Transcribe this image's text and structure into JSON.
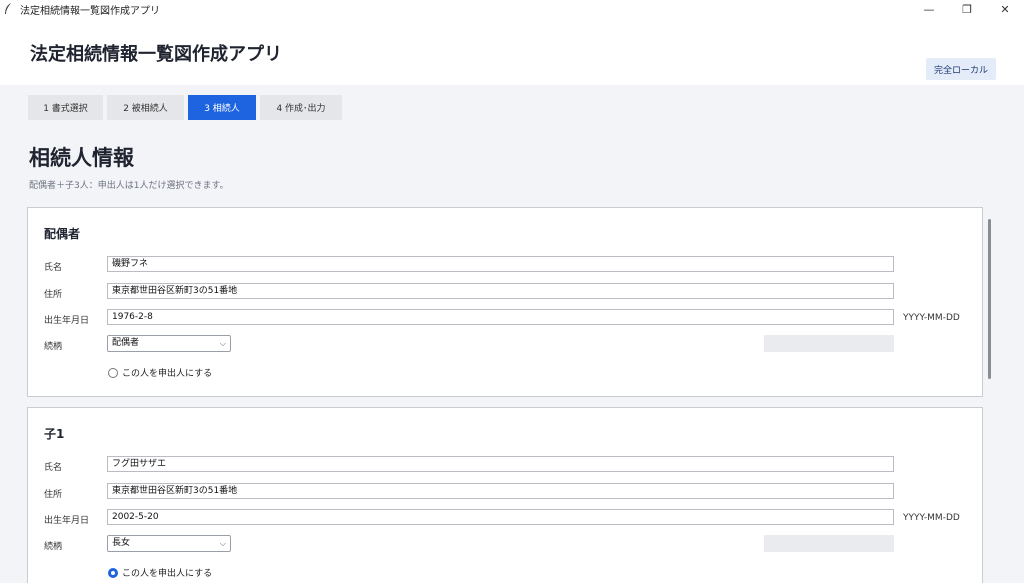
{
  "window": {
    "title": "法定相続情報一覧図作成アプリ",
    "minimize": "—",
    "restore": "❐",
    "close": "✕"
  },
  "header": {
    "app_title": "法定相続情報一覧図作成アプリ",
    "badge": "完全ローカル"
  },
  "steps": [
    {
      "label": "1  書式選択",
      "active": false
    },
    {
      "label": "2  被相続人",
      "active": false
    },
    {
      "label": "3  相続人",
      "active": true
    },
    {
      "label": "4  作成･出力",
      "active": false
    }
  ],
  "section": {
    "title": "相続人情報",
    "description": "配偶者＋子3人：申出人は1人だけ選択できます。"
  },
  "cards": [
    {
      "title": "配偶者",
      "name_label": "氏名",
      "name": "磯野フネ",
      "address_label": "住所",
      "address": "東京都世田谷区新町3の51番地",
      "birth_label": "出生年月日",
      "birth": "1976-2-8",
      "birth_format": "YYYY-MM-DD",
      "relation_label": "続柄",
      "relation": "配偶者",
      "applicant_label": "この人を申出人にする",
      "applicant": false
    },
    {
      "title": "子1",
      "name_label": "氏名",
      "name": "フグ田サザエ",
      "address_label": "住所",
      "address": "東京都世田谷区新町3の51番地",
      "birth_label": "出生年月日",
      "birth": "2002-5-20",
      "birth_format": "YYYY-MM-DD",
      "relation_label": "続柄",
      "relation": "長女",
      "applicant_label": "この人を申出人にする",
      "applicant": true
    }
  ],
  "colors": {
    "accent": "#1e63e0",
    "background": "#f3f4f8",
    "badge_bg": "#e4ecfa"
  }
}
